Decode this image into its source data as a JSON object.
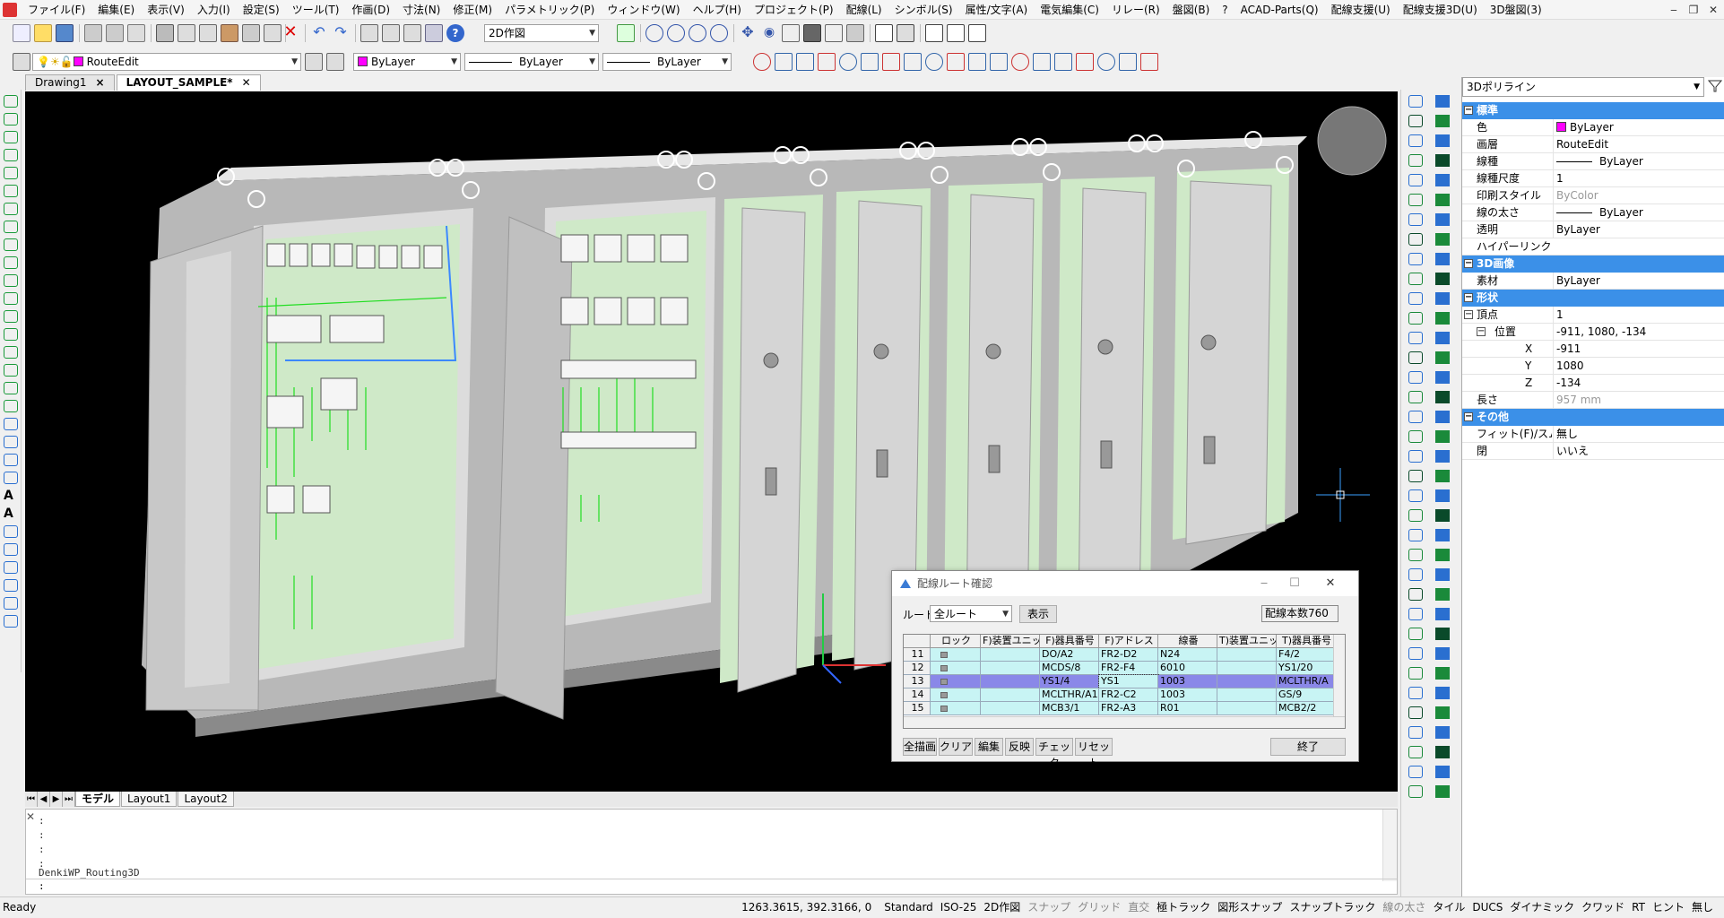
{
  "menu": [
    "ファイル(F)",
    "編集(E)",
    "表示(V)",
    "入力(I)",
    "設定(S)",
    "ツール(T)",
    "作画(D)",
    "寸法(N)",
    "修正(M)",
    "パラメトリック(P)",
    "ウィンドウ(W)",
    "ヘルプ(H)",
    "プロジェクト(P)",
    "配線(L)",
    "シンボル(S)",
    "属性/文字(A)",
    "電気編集(C)",
    "リレー(R)",
    "盤図(B)",
    "?",
    "ACAD-Parts(Q)",
    "配線支援(U)",
    "配線支援3D(U)",
    "3D盤図(3)"
  ],
  "toolbar": {
    "view_combo": "2D作図",
    "layer_combo": "RouteEdit",
    "color_combo": "ByLayer",
    "linetype_combo": "ByLayer",
    "lineweight_combo": "ByLayer"
  },
  "doc_tabs": [
    {
      "label": "Drawing1",
      "close": "×"
    },
    {
      "label": "LAYOUT_SAMPLE*",
      "close": "✕"
    }
  ],
  "layout_tabs": [
    "モデル",
    "Layout1",
    "Layout2"
  ],
  "command": {
    "history": [
      ":",
      ":",
      ":",
      ":",
      "DenkiWP_Routing3D"
    ],
    "prompt": ":"
  },
  "status": {
    "ready": "Ready",
    "coords": "1263.3615, 392.3166, 0",
    "items": [
      {
        "label": "Standard",
        "on": true
      },
      {
        "label": "ISO-25",
        "on": true
      },
      {
        "label": "2D作図",
        "on": true
      },
      {
        "label": "スナップ",
        "on": false
      },
      {
        "label": "グリッド",
        "on": false
      },
      {
        "label": "直交",
        "on": false
      },
      {
        "label": "極トラック",
        "on": true
      },
      {
        "label": "図形スナップ",
        "on": true
      },
      {
        "label": "スナップトラック",
        "on": true
      },
      {
        "label": "線の太さ",
        "on": false
      },
      {
        "label": "タイル",
        "on": true
      },
      {
        "label": "DUCS",
        "on": true
      },
      {
        "label": "ダイナミック",
        "on": true
      },
      {
        "label": "クワッド",
        "on": true
      },
      {
        "label": "RT",
        "on": true
      },
      {
        "label": "ヒント",
        "on": true
      },
      {
        "label": "無し",
        "on": true
      }
    ]
  },
  "properties": {
    "selector": "3Dポリライン",
    "sections": {
      "standard": "標準",
      "image3d": "3D画像",
      "shape": "形状",
      "other": "その他"
    },
    "rows": {
      "color": {
        "key": "色",
        "value": "ByLayer"
      },
      "layer": {
        "key": "画層",
        "value": "RouteEdit"
      },
      "linetype": {
        "key": "線種",
        "value": "ByLayer"
      },
      "ltscale": {
        "key": "線種尺度",
        "value": "1"
      },
      "plotstyle": {
        "key": "印刷スタイル",
        "value": "ByColor"
      },
      "lineweight": {
        "key": "線の太さ",
        "value": "ByLayer"
      },
      "transparency": {
        "key": "透明",
        "value": "ByLayer"
      },
      "hyperlink": {
        "key": "ハイパーリンク",
        "value": ""
      },
      "material": {
        "key": "素材",
        "value": "ByLayer"
      },
      "vertex": {
        "key": "頂点",
        "value": "1"
      },
      "position": {
        "key": "位置",
        "value": "-911, 1080, -134"
      },
      "x": {
        "key": "X",
        "value": "-911"
      },
      "y": {
        "key": "Y",
        "value": "1080"
      },
      "z": {
        "key": "Z",
        "value": "-134"
      },
      "length": {
        "key": "長さ",
        "value": "957 mm"
      },
      "fit": {
        "key": "フィット(F)/スムー",
        "value": "無し"
      },
      "closed": {
        "key": "閉",
        "value": "いいえ"
      }
    }
  },
  "dialog": {
    "title": "配線ルート確認",
    "route_label": "ルート",
    "route_value": "全ルート",
    "show_button": "表示",
    "count_label": "配線本数",
    "count_value": "760",
    "columns": [
      "",
      "ロック",
      "F)装置ユニッ",
      "F)器具番号",
      "F)アドレス",
      "線番",
      "T)装置ユニッ",
      "T)器具番号"
    ],
    "rows": [
      {
        "no": "11",
        "f_unit": "",
        "f_dev": "DO/A2",
        "f_addr": "FR2-D2",
        "wire": "N24",
        "t_unit": "",
        "t_dev": "F4/2"
      },
      {
        "no": "12",
        "f_unit": "",
        "f_dev": "MCDS/8",
        "f_addr": "FR2-F4",
        "wire": "6010",
        "t_unit": "",
        "t_dev": "YS1/20"
      },
      {
        "no": "13",
        "f_unit": "",
        "f_dev": "YS1/4",
        "f_addr": "YS1",
        "wire": "1003",
        "t_unit": "",
        "t_dev": "MCLTHR/A"
      },
      {
        "no": "14",
        "f_unit": "",
        "f_dev": "MCLTHR/A1",
        "f_addr": "FR2-C2",
        "wire": "1003",
        "t_unit": "",
        "t_dev": "GS/9"
      },
      {
        "no": "15",
        "f_unit": "",
        "f_dev": "MCB3/1",
        "f_addr": "FR2-A3",
        "wire": "R01",
        "t_unit": "",
        "t_dev": "MCB2/2"
      }
    ],
    "buttons": [
      "全描画",
      "クリア",
      "編集",
      "反映",
      "チェック",
      "リセット"
    ],
    "close_button": "終了"
  },
  "colors": {
    "cabinet": "#d9d9d9",
    "panel": "#c8e6c0",
    "wire": "#22dd22",
    "selection": "#8a88e8",
    "header": "#3b90e8"
  }
}
